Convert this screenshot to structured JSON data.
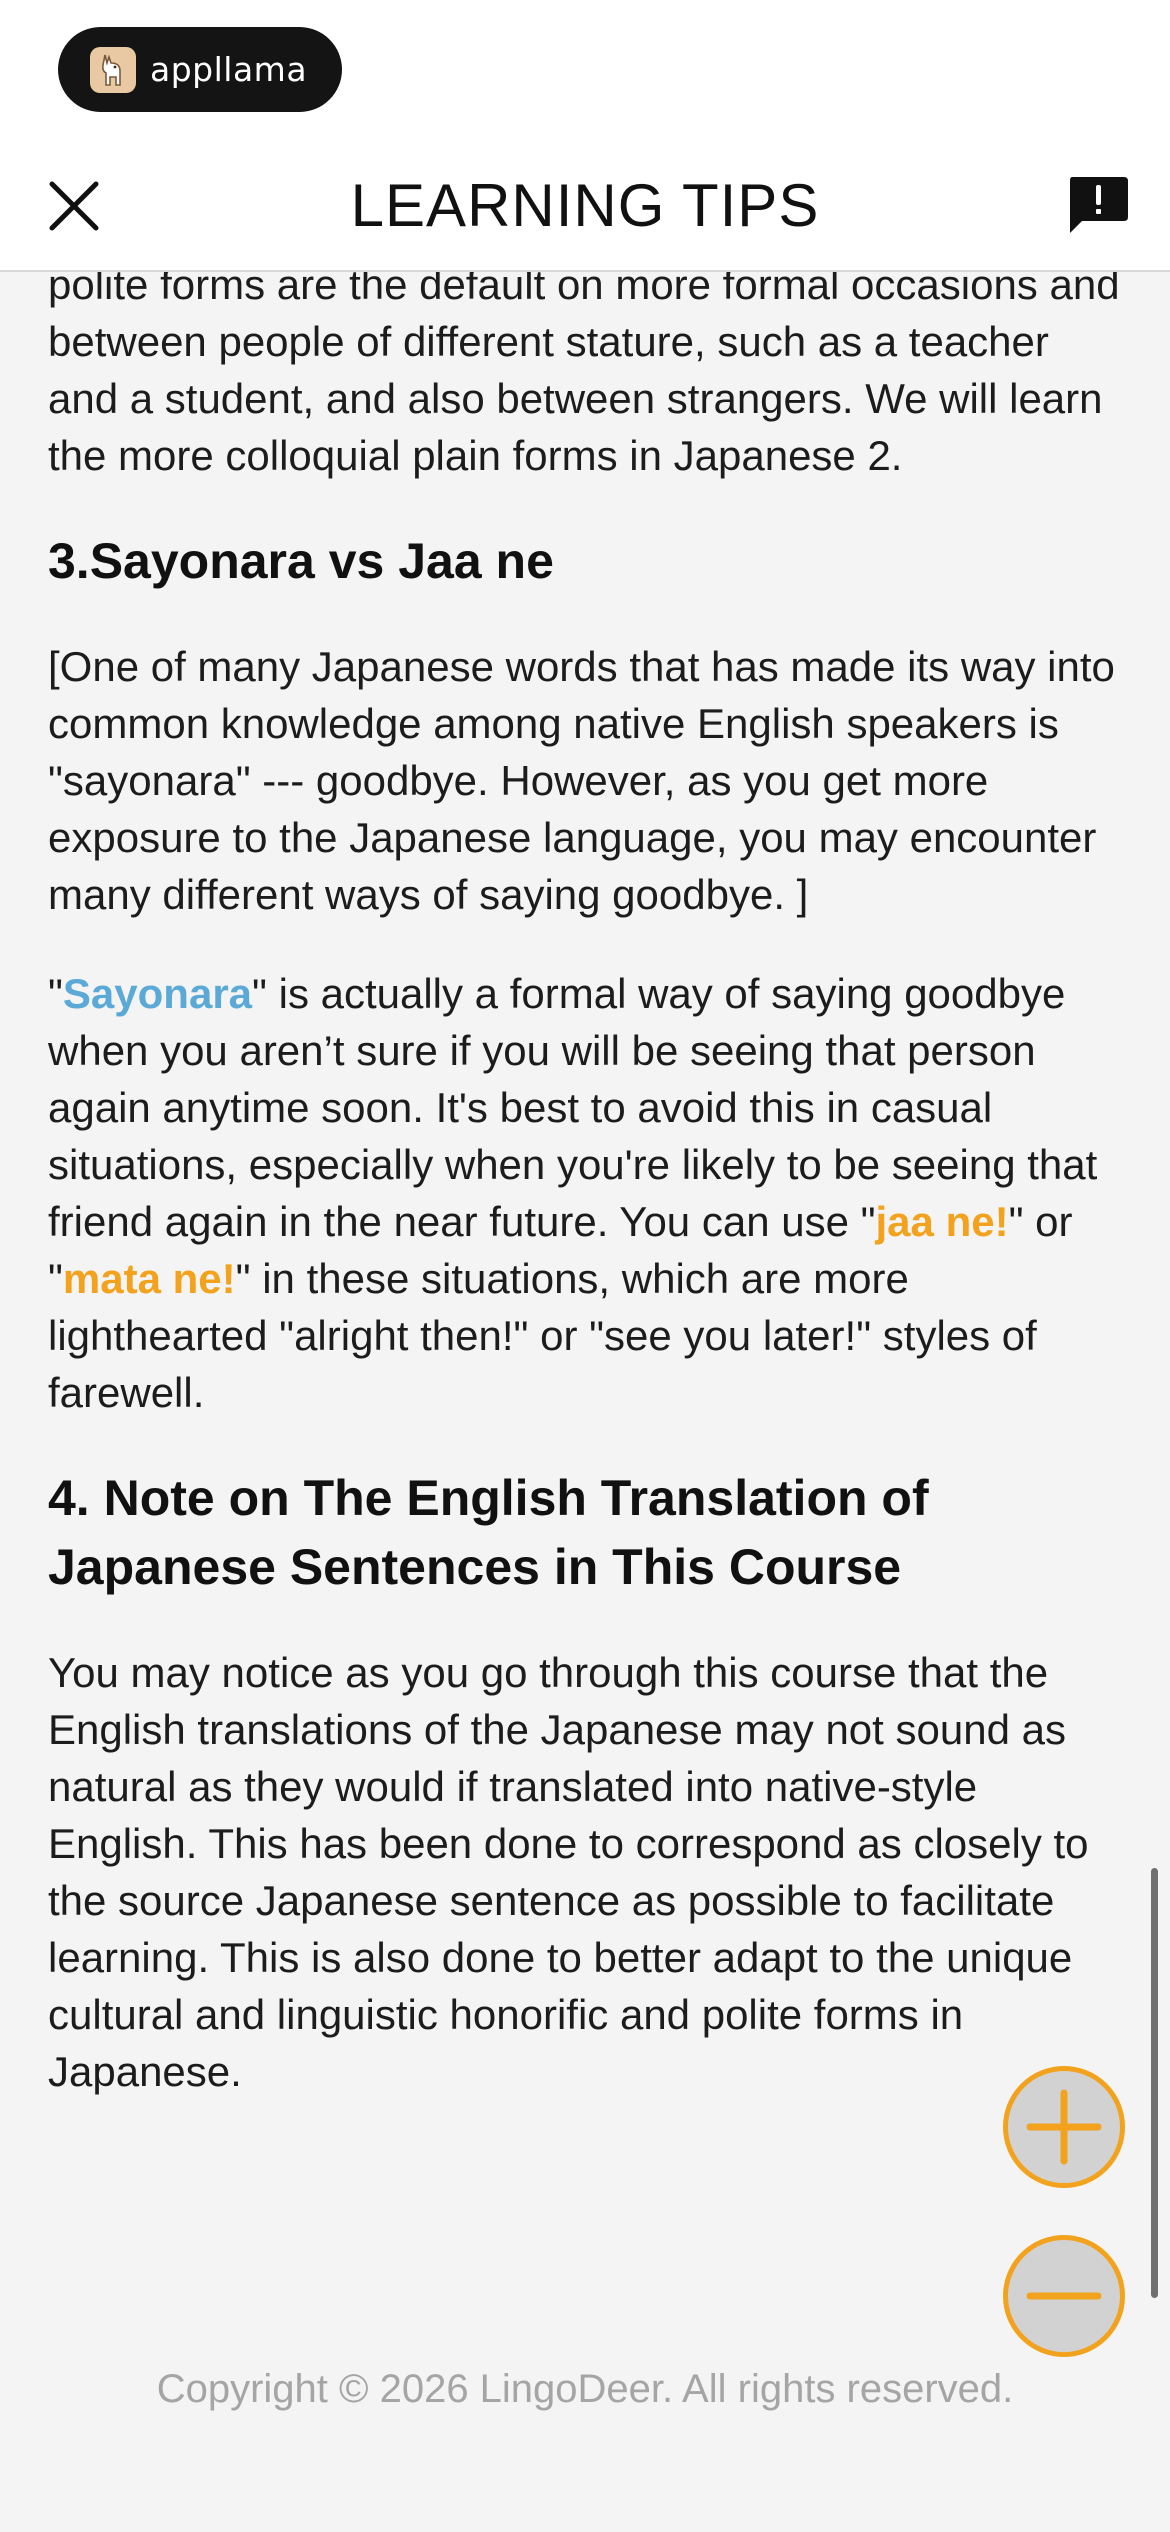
{
  "app_badge": {
    "label": "appllama",
    "icon": "llama-logo-icon"
  },
  "header": {
    "title": "LEARNING TIPS",
    "close_icon": "close-icon",
    "report_icon": "report-feedback-icon"
  },
  "content": {
    "intro_paragraph": "polite forms are the default on more formal occasions and between people of different stature, such as a teacher and a student, and also between strangers. We will learn the more colloquial plain forms in Japanese 2.",
    "section3": {
      "heading": "3.Sayonara vs Jaa ne",
      "quote": "[One of many Japanese words that has made its way into common knowledge among native English speakers is \"sayonara\" --- goodbye. However, as you get more exposure to the Japanese language, you may encounter many different ways of saying goodbye. ]",
      "p2": {
        "q_open": "\"",
        "term_sayonara": "Sayonara",
        "text_1": "\" is actually a formal way of saying goodbye when you aren’t sure if you will be seeing that person again anytime soon. It's best to avoid this in casual situations, especially when you're likely to be seeing that friend again in the near future. You can use \"",
        "term_jaa_ne": "jaa ne!",
        "text_2": "\" or \"",
        "term_mata_ne": "mata ne!",
        "text_3": "\" in these situations, which are more lighthearted \"alright then!\" or \"see you later!\" styles of farewell."
      }
    },
    "section4": {
      "heading": "4. Note on The English Translation of Japanese Sentences in This Course",
      "paragraph": "You may notice as you go through this course that the English translations of the Japanese may not sound as natural as they would if translated into native-style English. This has been done to correspond as closely to the source Japanese sentence as possible to facilitate learning. This is also done to better adapt to the unique cultural and linguistic honorific and polite forms in Japanese."
    }
  },
  "zoom_controls": {
    "zoom_in_icon": "plus-icon",
    "zoom_out_icon": "minus-icon"
  },
  "footer": {
    "copyright": "Copyright © 2026 LingoDeer. All rights reserved."
  },
  "colors": {
    "accent_orange": "#f2a21c",
    "accent_blue": "#5aa9d6",
    "background": "#f4f4f4"
  }
}
